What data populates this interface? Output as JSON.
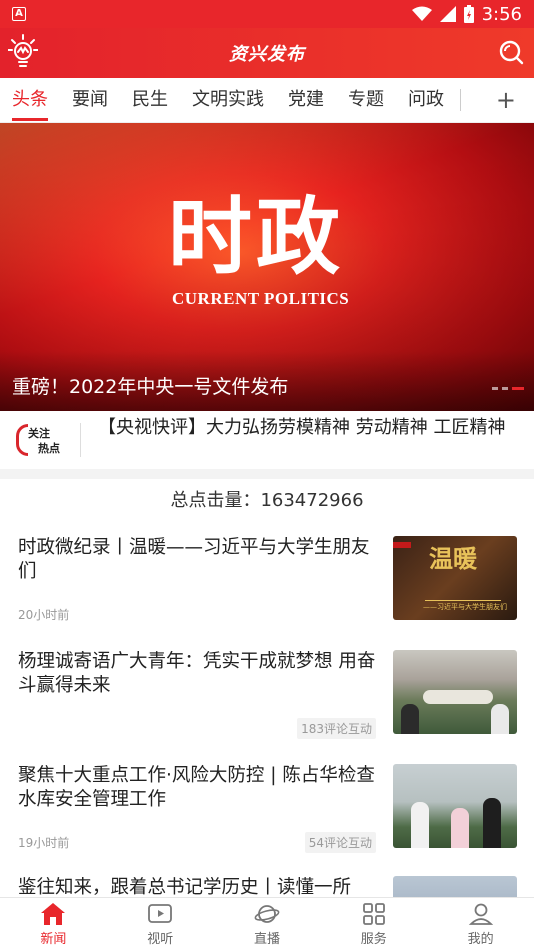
{
  "status_bar": {
    "time": "3:56",
    "app_indicator": "A",
    "icons": [
      "wifi-icon",
      "signal-icon",
      "battery-charging-icon"
    ]
  },
  "header": {
    "title": "资兴发布",
    "logo": "lightbulb-logo-icon",
    "search": "search-icon"
  },
  "tabs": {
    "items": [
      "头条",
      "要闻",
      "民生",
      "文明实践",
      "党建",
      "专题",
      "问政"
    ],
    "active_index": 0,
    "add_label": "+"
  },
  "banner": {
    "big_text": "时政",
    "sub_text": "CURRENT POLITICS",
    "caption": "重磅！2022年中央一号文件发布",
    "slide_count": 3,
    "active_slide": 3
  },
  "hot": {
    "badge_line1": "关注",
    "badge_line2": "热点",
    "headline": "【央视快评】大力弘扬劳模精神 劳动精神 工匠精神"
  },
  "counter": {
    "label": "总点击量：163472966"
  },
  "news": [
    {
      "title": "时政微纪录丨温暖——习近平与大学生朋友们",
      "time": "20小时前",
      "comments": "",
      "thumb_text": "温暖",
      "thumb_subtext": "——习近平与大学生朋友们"
    },
    {
      "title": "杨理诚寄语广大青年：凭实干成就梦想 用奋斗赢得未来",
      "time": "",
      "comments": "183评论互动"
    },
    {
      "title": "聚焦十大重点工作·风险大防控 | 陈占华检查水库安全管理工作",
      "time": "19小时前",
      "comments": "54评论互动"
    },
    {
      "title": "鉴往知来，跟着总书记学历史丨读懂一所",
      "time": "",
      "comments": ""
    }
  ],
  "bottom_nav": {
    "items": [
      {
        "label": "新闻",
        "icon": "home-icon"
      },
      {
        "label": "视听",
        "icon": "play-icon"
      },
      {
        "label": "直播",
        "icon": "planet-icon"
      },
      {
        "label": "服务",
        "icon": "grid-icon"
      },
      {
        "label": "我的",
        "icon": "user-icon"
      }
    ],
    "active_index": 0
  },
  "colors": {
    "brand_red": "#e8262b",
    "text": "#222222",
    "muted": "#999999"
  }
}
